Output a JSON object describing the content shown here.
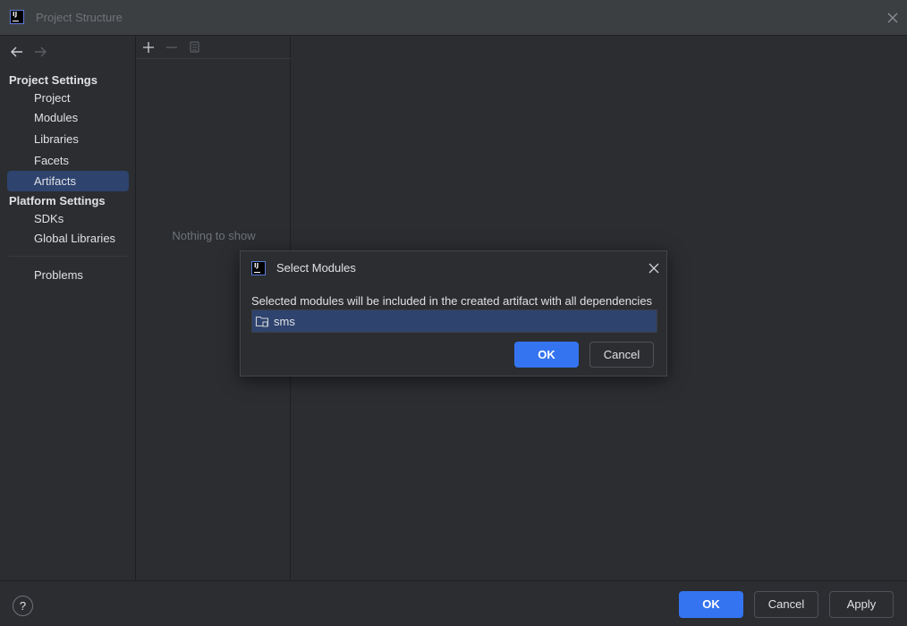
{
  "window": {
    "title": "Project Structure",
    "close_icon": "close-icon",
    "logo_text": "IJ"
  },
  "sidebar": {
    "project_settings_header": "Project Settings",
    "project_items": [
      "Project",
      "Modules",
      "Libraries",
      "Facets",
      "Artifacts"
    ],
    "selected_item": "Artifacts",
    "platform_settings_header": "Platform Settings",
    "platform_items": [
      "SDKs",
      "Global Libraries"
    ],
    "other_items": [
      "Problems"
    ]
  },
  "middle": {
    "toolbar_icons": [
      "add-icon",
      "remove-icon",
      "copy-icon"
    ],
    "empty_text": "Nothing to show"
  },
  "dialog": {
    "title": "Select Modules",
    "description": "Selected modules will be included in the created artifact with all dependencies",
    "modules": [
      "sms"
    ],
    "ok_label": "OK",
    "cancel_label": "Cancel"
  },
  "footer": {
    "help_label": "?",
    "ok_label": "OK",
    "cancel_label": "Cancel",
    "apply_label": "Apply"
  },
  "colors": {
    "accent": "#3574f0",
    "selection": "#2e436e",
    "background": "#2b2d30"
  }
}
